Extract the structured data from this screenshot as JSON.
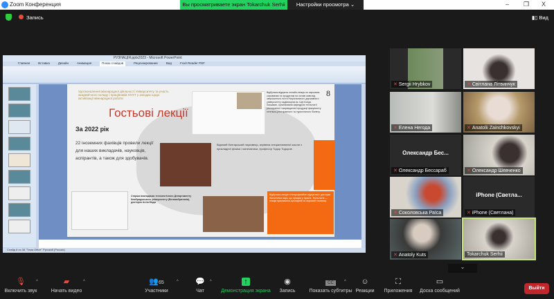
{
  "window": {
    "title": "Zoom Конференция",
    "minimize": "–",
    "restore": "❐",
    "close": "X"
  },
  "banner": {
    "text": "Вы просматриваете экран Tokarchuk Serhii",
    "view_options": "Настройки просмотра ⌄"
  },
  "topbar": {
    "record_label": "Запись",
    "view_label": "Вид"
  },
  "powerpoint": {
    "title": "РУЗНАЦІЯ.pptx2023 - Microsoft PowerPoint",
    "tabs": [
      "Главная",
      "Вставка",
      "Дизайн",
      "Анимация",
      "Показ слайдов",
      "Рецензирование",
      "Вид",
      "Foxit Reader PDF"
    ],
    "active_tab": "Показ слайдов",
    "status": "Слайд 8 из 38   \"Тема Office\"   Русский (Россия)"
  },
  "slide": {
    "subtitle": "Удосконалення міжнародної діяльності Університету та участь академічного складу і працівників НУХТ у заходах щодо активізації міжнародної роботи",
    "title": "Гостьові лекції",
    "year": "За  2022 рік",
    "body": "22 іноземних фахівців провели лекції для наших викладачів, науковців, аспірантів, а також для здобувачів.",
    "page_number": "8",
    "text_top_right": "Відбулася відкрита онлайн-лекція по харчовим сировинам та продуктам на основі кави від запрошеного гостя Національного державного університету садівництва ім. Шрі Конда Лакшман, організована кафедрою технології ресторанної і аюрведичної продукції факультету готельно-ресторанного та туристичного бізнесу.",
    "text_middle": "Відомий болгарський науковець, керівник спеціалізованої школи з прикладної фізики і математики, професор Тодор Тодоров",
    "text_bottom_left": "Старша викладачка технологічного Департаменту Кембриджського університету (Великобританія), докторка Алла Мадж",
    "text_orange": "Відбулася лекція «Непрофесійне лідерство» докторки біологічних наук, що працює у Ізраїлі. Технологія — лекція присвячена кулінарній та харчовій тематиці."
  },
  "participants": [
    {
      "name": "Sergii Hrybkov"
    },
    {
      "name": "Світлана Літвинчук"
    },
    {
      "name": "Елена Негода"
    },
    {
      "name": "Anatolii Zainchkovskyi"
    },
    {
      "name": "Олександр Бессараб",
      "display": "Олександр  Бес..."
    },
    {
      "name": "Олександр Шевченко"
    },
    {
      "name": "Соколовська Раїса"
    },
    {
      "name": "iPhone (Светлана)",
      "display": "iPhone  (Светла..."
    },
    {
      "name": "Anatoly Kuts"
    },
    {
      "name": "Tokarchuk Serhii"
    }
  ],
  "toolbar": {
    "unmute": "Включить звук",
    "start_video": "Начать видео",
    "participants": "Участники",
    "participants_count": "65",
    "chat": "Чат",
    "share_screen": "Демонстрация экрана",
    "record": "Запись",
    "captions": "Показать субтитры",
    "reactions": "Реакции",
    "apps": "Приложения",
    "whiteboard": "Доска сообщений",
    "leave": "Выйти"
  },
  "colors": {
    "accent_green": "#23d160",
    "leave_red": "#c0272d",
    "slide_orange": "#f46a12",
    "slide_title_red": "#c0392b"
  }
}
